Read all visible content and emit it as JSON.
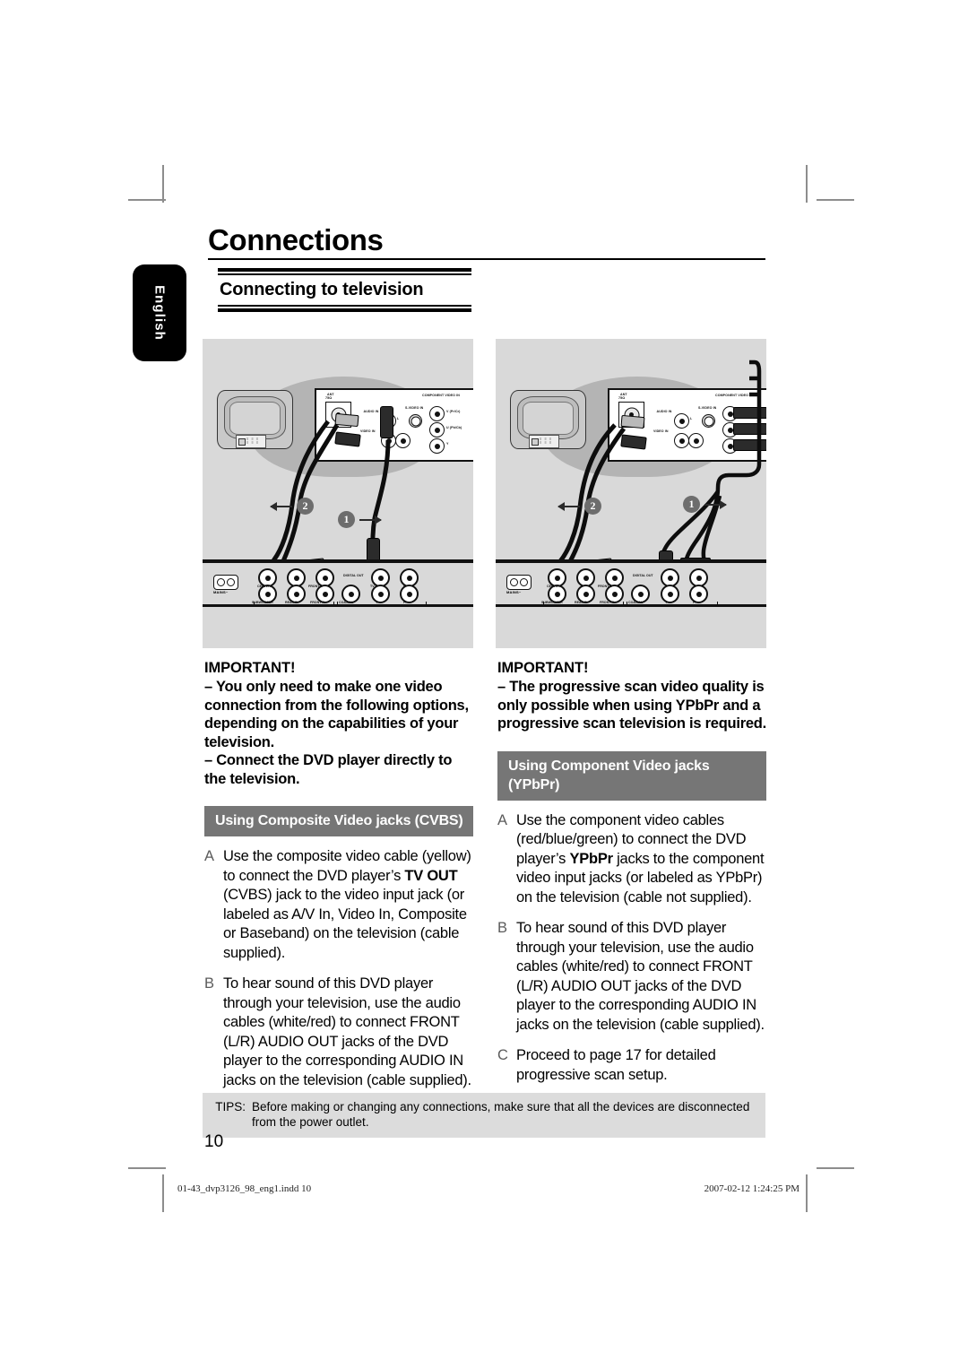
{
  "document": {
    "page_title": "Connections",
    "section_title": "Connecting to television",
    "language_tab": "English",
    "page_number": "10"
  },
  "footer": {
    "tips_label": "TIPS:",
    "tips_text": "Before making or changing any connections, make sure that all the devices are disconnected from the power outlet.",
    "file_name": "01-43_dvp3126_98_eng1.indd  10",
    "print_stamp": "2007-02-12  1:24:25 PM"
  },
  "diagrams": {
    "composite": {
      "caption": "composite-video-connection-diagram",
      "tv_rear_labels": {
        "ant": "ANT",
        "ant_sub": "75Ω",
        "audio_in": "AUDIO IN",
        "audio_l": "L",
        "audio_r": "R",
        "video_in": "VIDEO IN",
        "s_video_in": "S-VIDEO IN",
        "component_video_in": "COMPONENT VIDEO IN",
        "comp_v": "V (Pr/Cr)",
        "comp_u": "U (Pb/Cb)",
        "comp_y": "Y"
      },
      "dvd_rear_labels": {
        "mains": "MAINS~",
        "center": "CENTER",
        "front_l": "FRONT L",
        "subwoofer": "SUBWOOFER",
        "rear_r": "REAR R",
        "front_r": "FRONT R",
        "digital_out": "DIGITAL OUT",
        "coaxial": "COAXIAL",
        "audio_out": "AUDIO OUT",
        "tv_out": "TV OUT",
        "pb": "Pb",
        "y": "Y",
        "pr": "Pr",
        "component_video_out": "COMPONENT VIDEO OUT"
      },
      "steps": [
        "1",
        "2"
      ]
    },
    "component": {
      "caption": "component-video-connection-diagram",
      "tv_rear_labels": {
        "ant": "ANT",
        "ant_sub": "75Ω",
        "audio_in": "AUDIO IN",
        "audio_l": "L",
        "audio_r": "R",
        "video_in": "VIDEO IN",
        "s_video_in": "S-VIDEO IN",
        "component_video_in": "COMPONENT VIDEO IN"
      },
      "dvd_rear_labels": {
        "mains": "MAINS~",
        "center": "CENTER",
        "front_l": "FRONT L",
        "subwoofer": "SUBWOOFER",
        "rear_r": "REAR R",
        "front_r": "FRONT R",
        "digital_out": "DIGITAL OUT",
        "coaxial": "COAXIAL",
        "audio_out": "AUDIO OUT",
        "component_video_out": "COMPONENT VIDEO OUT",
        "y": "Y",
        "pb": "Pb",
        "pr": "Pr"
      },
      "steps": [
        "1",
        "2"
      ]
    }
  },
  "left_column": {
    "important_title": "IMPORTANT!",
    "important_lines": [
      "– You only need to make one video connection from the following options, depending on the capabilities of your television.",
      "– Connect the DVD player directly to the television."
    ],
    "subhead": "Using Composite Video jacks (CVBS)",
    "steps": [
      {
        "letter": "A",
        "text_before": "Use the composite video cable (yellow) to connect the DVD player’s ",
        "bold": "TV OUT",
        "text_after": " (CVBS) jack to the video input jack (or labeled as A/V In, Video In, Composite or Baseband) on the television (cable supplied)."
      },
      {
        "letter": "B",
        "text_before": "To hear sound of this DVD player through your television, use the audio cables (white/red) to connect FRONT (L/R) AUDIO OUT jacks of the DVD player to the corresponding AUDIO IN jacks on the television (cable supplied).",
        "bold": "",
        "text_after": ""
      }
    ]
  },
  "right_column": {
    "important_title": "IMPORTANT!",
    "important_lines": [
      "– The progressive scan video quality is only possible when using YPbPr and a progressive scan television is required."
    ],
    "subhead": "Using Component Video jacks (YPbPr)",
    "steps": [
      {
        "letter": "A",
        "text_before": "Use the component video cables (red/blue/green) to connect the DVD player’s ",
        "bold": "YPbPr",
        "text_after": " jacks to the component video input jacks (or labeled as YPbPr) on the television (cable not supplied)."
      },
      {
        "letter": "B",
        "text_before": "To hear sound of this DVD player through your television, use the audio cables (white/red) to connect FRONT (L/R) AUDIO OUT jacks of the DVD player to the corresponding AUDIO IN jacks on the television (cable supplied).",
        "bold": "",
        "text_after": ""
      },
      {
        "letter": "C",
        "text_before": "Proceed to page 17 for detailed progressive scan setup.",
        "bold": "",
        "text_after": ""
      }
    ]
  },
  "colors": {
    "panel_gray": "#d9d9d9",
    "subhead_gray": "#767676",
    "tips_gray": "#dcdcdc",
    "tab_black": "#000000"
  }
}
